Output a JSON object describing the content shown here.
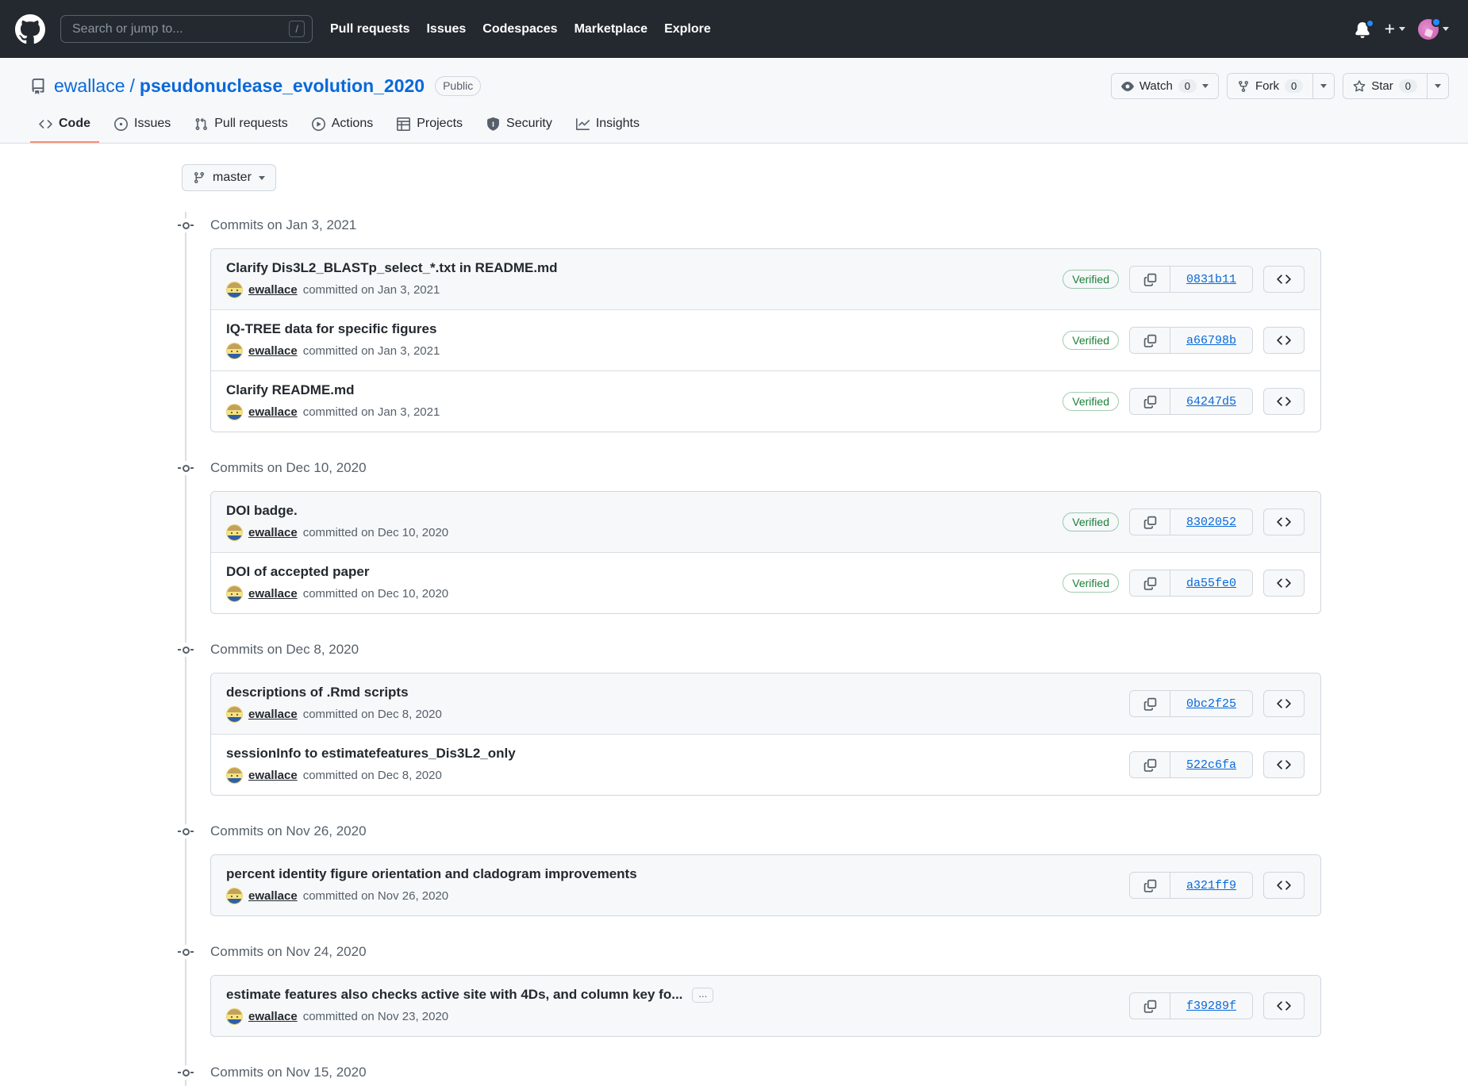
{
  "header": {
    "logo_icon": "github-mark-icon",
    "search": {
      "placeholder": "Search or jump to...",
      "value": "",
      "shortcut_key": "/"
    },
    "nav": [
      {
        "label": "Pull requests"
      },
      {
        "label": "Issues"
      },
      {
        "label": "Codespaces"
      },
      {
        "label": "Marketplace"
      },
      {
        "label": "Explore"
      }
    ],
    "notifications_icon": "bell-icon",
    "create_new_icon": "plus-icon",
    "profile_icon": "avatar-icon"
  },
  "repo": {
    "icon": "repo-icon",
    "owner": "ewallace",
    "separator": "/",
    "name": "pseudonuclease_evolution_2020",
    "visibility": "Public",
    "actions": [
      {
        "name": "watch",
        "icon": "eye-icon",
        "label": "Watch",
        "count": "0",
        "has_caret": true
      },
      {
        "name": "fork",
        "icon": "fork-icon",
        "label": "Fork",
        "count": "0",
        "has_caret": true
      },
      {
        "name": "star",
        "icon": "star-icon",
        "label": "Star",
        "count": "0",
        "has_caret": true
      }
    ],
    "tabs": [
      {
        "label": "Code",
        "icon": "code-icon",
        "active": true
      },
      {
        "label": "Issues",
        "icon": "issue-opened-icon",
        "active": false
      },
      {
        "label": "Pull requests",
        "icon": "git-pull-request-icon",
        "active": false
      },
      {
        "label": "Actions",
        "icon": "play-icon",
        "active": false
      },
      {
        "label": "Projects",
        "icon": "table-icon",
        "active": false
      },
      {
        "label": "Security",
        "icon": "shield-icon",
        "active": false
      },
      {
        "label": "Insights",
        "icon": "graph-icon",
        "active": false
      }
    ]
  },
  "branch_selector": {
    "icon": "git-branch-icon",
    "label": "master",
    "caret": "chevron-down-icon"
  },
  "copy_icon": "copy-icon",
  "browse_code_icon": "code-brackets-icon",
  "verified_label": "Verified",
  "ellipsis_label": "...",
  "commit_groups": [
    {
      "date_label": "Commits on Jan 3, 2021",
      "commits": [
        {
          "title": "Clarify Dis3L2_BLASTp_select_*.txt in README.md",
          "author": "ewallace",
          "committed_text": "committed on Jan 3, 2021",
          "verified": true,
          "sha": "0831b11",
          "truncated": false
        },
        {
          "title": "IQ-TREE data for specific figures",
          "author": "ewallace",
          "committed_text": "committed on Jan 3, 2021",
          "verified": true,
          "sha": "a66798b",
          "truncated": false
        },
        {
          "title": "Clarify README.md",
          "author": "ewallace",
          "committed_text": "committed on Jan 3, 2021",
          "verified": true,
          "sha": "64247d5",
          "truncated": false
        }
      ]
    },
    {
      "date_label": "Commits on Dec 10, 2020",
      "commits": [
        {
          "title": "DOI badge.",
          "author": "ewallace",
          "committed_text": "committed on Dec 10, 2020",
          "verified": true,
          "sha": "8302052",
          "truncated": false
        },
        {
          "title": "DOI of accepted paper",
          "author": "ewallace",
          "committed_text": "committed on Dec 10, 2020",
          "verified": true,
          "sha": "da55fe0",
          "truncated": false
        }
      ]
    },
    {
      "date_label": "Commits on Dec 8, 2020",
      "commits": [
        {
          "title": "descriptions of .Rmd scripts",
          "author": "ewallace",
          "committed_text": "committed on Dec 8, 2020",
          "verified": false,
          "sha": "0bc2f25",
          "truncated": false
        },
        {
          "title": "sessionInfo to estimatefeatures_Dis3L2_only",
          "author": "ewallace",
          "committed_text": "committed on Dec 8, 2020",
          "verified": false,
          "sha": "522c6fa",
          "truncated": false
        }
      ]
    },
    {
      "date_label": "Commits on Nov 26, 2020",
      "commits": [
        {
          "title": "percent identity figure orientation and cladogram improvements",
          "author": "ewallace",
          "committed_text": "committed on Nov 26, 2020",
          "verified": false,
          "sha": "a321ff9",
          "truncated": false
        }
      ]
    },
    {
      "date_label": "Commits on Nov 24, 2020",
      "commits": [
        {
          "title": "estimate features also checks active site with 4Ds, and column key fo...",
          "author": "ewallace",
          "committed_text": "committed on Nov 23, 2020",
          "verified": false,
          "sha": "f39289f",
          "truncated": true
        }
      ]
    },
    {
      "date_label": "Commits on Nov 15, 2020",
      "commits": []
    }
  ],
  "colors": {
    "header_bg": "#24292f",
    "link": "#0969da",
    "verified_green": "#1a7f37",
    "border": "#d0d7de",
    "active_tab_underline": "#fd8c73"
  }
}
